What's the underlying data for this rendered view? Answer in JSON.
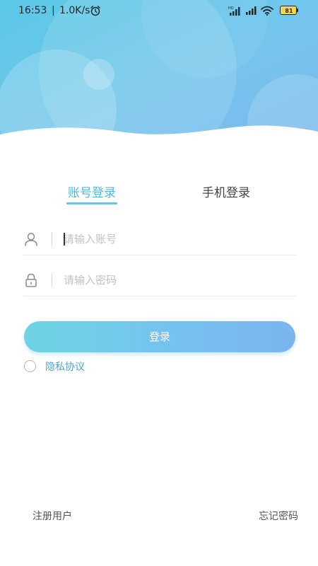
{
  "status_bar": {
    "time": "16:53",
    "separator": "|",
    "net_speed": "1.0K/s",
    "battery_level": "81"
  },
  "tabs": [
    {
      "label": "账号登录",
      "active": true
    },
    {
      "label": "手机登录",
      "active": false
    }
  ],
  "form": {
    "account_placeholder": "请输入账号",
    "password_placeholder": "请输入密码"
  },
  "login_button": {
    "label": "登录"
  },
  "privacy": {
    "label": "隐私协议"
  },
  "footer": {
    "register_label": "注册用户",
    "forgot_label": "忘记密码"
  },
  "colors": {
    "accent": "#4fb7dd",
    "header_top": "#5dc6e8",
    "button_start": "#6fd3e4",
    "button_end": "#7ab4f1"
  }
}
